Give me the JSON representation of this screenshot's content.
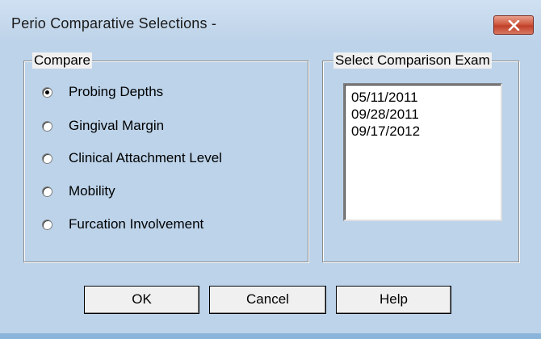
{
  "window": {
    "title": "Perio Comparative Selections -"
  },
  "compare": {
    "label": "Compare",
    "options": [
      {
        "label": "Probing Depths",
        "selected": true
      },
      {
        "label": "Gingival Margin",
        "selected": false
      },
      {
        "label": "Clinical Attachment Level",
        "selected": false
      },
      {
        "label": "Mobility",
        "selected": false
      },
      {
        "label": "Furcation Involvement",
        "selected": false
      }
    ]
  },
  "exam": {
    "label": "Select Comparison Exam",
    "items": [
      "05/11/2011",
      "09/28/2011",
      "09/17/2012"
    ]
  },
  "buttons": {
    "ok": "OK",
    "cancel": "Cancel",
    "help": "Help"
  },
  "colors": {
    "close_button": "#c74a32",
    "window_frame": "#bcd3ea",
    "dialog_bg": "#f0f0f0"
  },
  "icons": {
    "close": "close-x-icon",
    "radio_selected": "radio-dot"
  }
}
